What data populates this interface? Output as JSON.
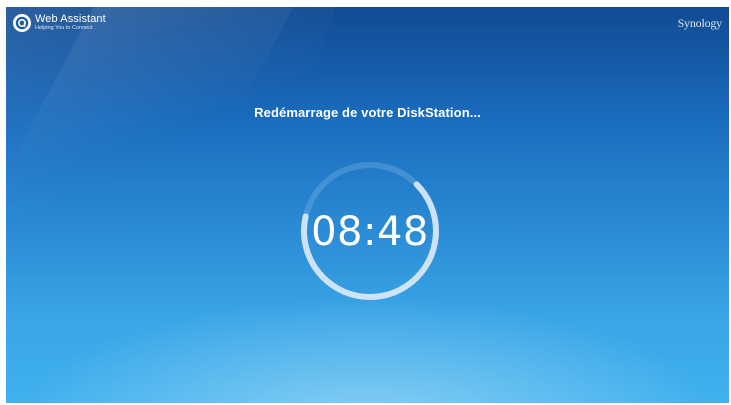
{
  "header": {
    "app_title": "Web Assistant",
    "app_subtitle": "Helping You to Connect",
    "vendor": "Synology"
  },
  "main": {
    "status_text": "Redémarrage de votre DiskStation...",
    "countdown": "08:48",
    "progress_fraction": 0.66
  },
  "colors": {
    "background_top": "#114b93",
    "background_bottom": "#3fb1ee",
    "ring_track": "#7fb8e8",
    "ring_progress": "#dbeaf7",
    "text": "#ffffff"
  },
  "icons": {
    "app_logo": "web-assistant-logo-icon"
  }
}
